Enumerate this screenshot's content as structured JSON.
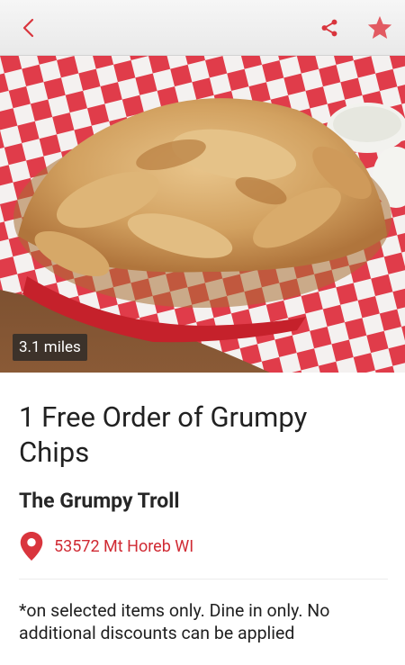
{
  "toolbar": {
    "back_icon": "chevron-left-icon",
    "share_icon": "share-icon",
    "favorite_icon": "star-icon",
    "accent_color": "#d9353d"
  },
  "hero": {
    "distance": "3.1 miles"
  },
  "deal": {
    "title": "1 Free Order of  Grumpy Chips",
    "merchant": "The Grumpy Troll",
    "location": "53572 Mt Horeb WI",
    "location_icon": "map-pin-icon",
    "terms": "*on selected items only. Dine in only. No additional discounts can be applied"
  }
}
